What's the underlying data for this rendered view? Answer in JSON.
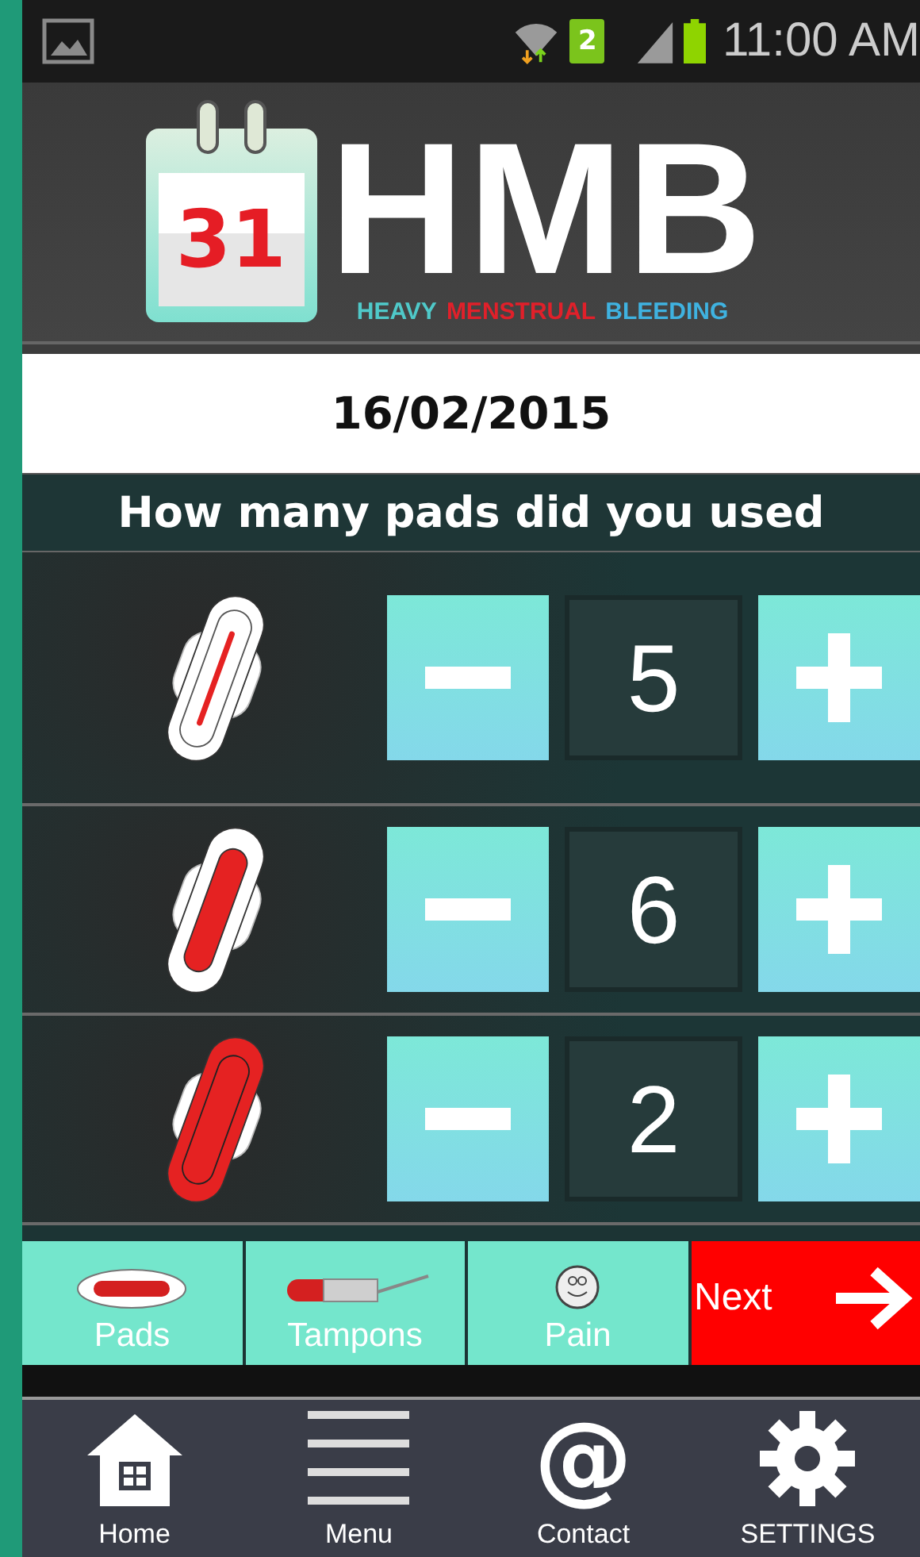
{
  "status_bar": {
    "sim": "2",
    "time": "11:00 AM"
  },
  "header": {
    "calendar_day": "31",
    "title": "HMB",
    "subtitle": [
      {
        "text": "HEAVY",
        "color": "#4fc9c9"
      },
      {
        "text": "MENSTRUAL",
        "color": "#e0202a"
      },
      {
        "text": "BLEEDING",
        "color": "#3fb2e0"
      }
    ]
  },
  "date": "16/02/2015",
  "question": "How many pads did you used",
  "counters": [
    {
      "kind": "light",
      "value": "5"
    },
    {
      "kind": "medium",
      "value": "6"
    },
    {
      "kind": "heavy",
      "value": "2"
    }
  ],
  "tabs": [
    {
      "kind": "pads",
      "label": "Pads"
    },
    {
      "kind": "tampons",
      "label": "Tampons"
    },
    {
      "kind": "pain",
      "label": "Pain"
    },
    {
      "kind": "next",
      "label": "Next"
    }
  ],
  "nav": [
    {
      "kind": "home",
      "label": "Home"
    },
    {
      "kind": "menu",
      "label": "Menu"
    },
    {
      "kind": "contact",
      "label": "Contact",
      "glyph": "@"
    },
    {
      "kind": "settings",
      "label": "SETTINGS"
    }
  ]
}
